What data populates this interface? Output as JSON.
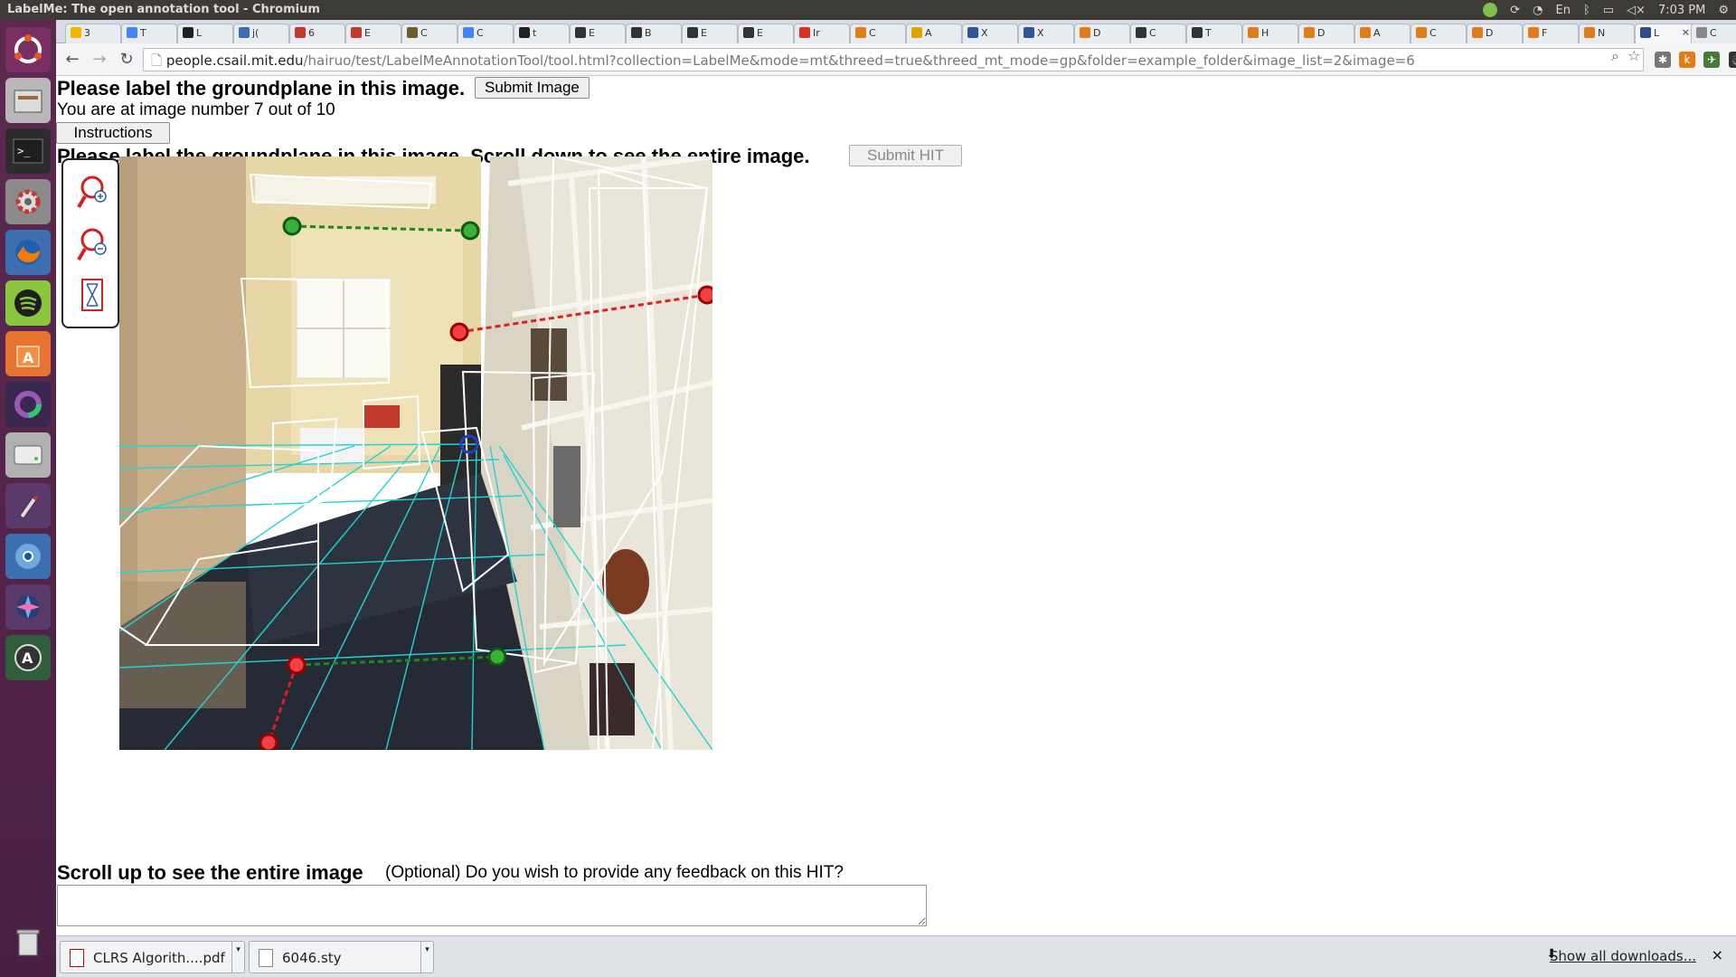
{
  "system_bar": {
    "window_title": "LabelMe: The open annotation tool - Chromium",
    "keyboard_layout": "En",
    "clock": "7:03 PM"
  },
  "launcher": {
    "icons": [
      "ubuntu-dash-icon",
      "files-icon",
      "terminal-icon",
      "system-settings-icon",
      "firefox-icon",
      "spotify-icon",
      "software-center-icon",
      "unity-tweak-icon",
      "disk-icon",
      "paint-icon",
      "chromium-icon",
      "shutter-icon",
      "update-manager-icon",
      "trash-icon"
    ]
  },
  "tabs": [
    {
      "label": "3",
      "color": "#f4b400"
    },
    {
      "label": "T",
      "color": "#4285f4"
    },
    {
      "label": "L",
      "color": "#222222"
    },
    {
      "label": "j(",
      "color": "#3b6db3"
    },
    {
      "label": "6",
      "color": "#c0392b"
    },
    {
      "label": "E",
      "color": "#c0392b"
    },
    {
      "label": "C",
      "color": "#6a5e2b"
    },
    {
      "label": "C",
      "color": "#4285f4"
    },
    {
      "label": "t",
      "color": "#222222"
    },
    {
      "label": "E",
      "color": "#333333"
    },
    {
      "label": "B",
      "color": "#333333"
    },
    {
      "label": "E",
      "color": "#333333"
    },
    {
      "label": "E",
      "color": "#333333"
    },
    {
      "label": "Ir",
      "color": "#d93025"
    },
    {
      "label": "C",
      "color": "#e07b1a"
    },
    {
      "label": "A",
      "color": "#e0a400"
    },
    {
      "label": "X",
      "color": "#2f5597"
    },
    {
      "label": "X",
      "color": "#2f5597"
    },
    {
      "label": "D",
      "color": "#e07b1a"
    },
    {
      "label": "C",
      "color": "#333333"
    },
    {
      "label": "T",
      "color": "#333333"
    },
    {
      "label": "H",
      "color": "#e07b1a"
    },
    {
      "label": "D",
      "color": "#e07b1a"
    },
    {
      "label": "A",
      "color": "#e07b1a"
    },
    {
      "label": "C",
      "color": "#e07b1a"
    },
    {
      "label": "D",
      "color": "#e07b1a"
    },
    {
      "label": "F",
      "color": "#e07b1a"
    },
    {
      "label": "N",
      "color": "#e07b1a"
    },
    {
      "label": "L",
      "color": "#2a4f8a",
      "active": true
    },
    {
      "label": "C",
      "color": "#888888"
    }
  ],
  "toolbar": {
    "url_host": "people.csail.mit.edu",
    "url_path": "/hairuo/test/LabelMeAnnotationTool/tool.html?collection=LabelMe&mode=mt&threed=true&threed_mt_mode=gp&folder=example_folder&image_list=2&image=6"
  },
  "page": {
    "heading": "Please label the groundplane in this image.",
    "submit_image_label": "Submit Image",
    "image_counter": "You are at image number 7 out of 10",
    "instructions_label": "Instructions",
    "heading2": "Please label the groundplane in this image. Scroll down to see the entire image.",
    "submit_hit_label": "Submit HIT",
    "scroll_up_text": "Scroll up to see the entire image",
    "feedback_question": "(Optional) Do you wish to provide any feedback on this HIT?",
    "feedback_value": ""
  },
  "tools": [
    "zoom-in-icon",
    "zoom-out-icon",
    "fit-image-icon"
  ],
  "downloads": {
    "items": [
      {
        "name": "CLRS Algorith....pdf",
        "type": "pdf"
      },
      {
        "name": "6046.sty",
        "type": "file"
      }
    ],
    "show_all_label": "Show all downloads...",
    "close_label": "×"
  },
  "colors": {
    "groundplane_grid": "#22d3d3",
    "vanishing_line_red": "#e02020",
    "vanishing_line_green": "#1a8a1a",
    "handle_blue": "#2040c0",
    "box_outline": "#ffffff"
  }
}
